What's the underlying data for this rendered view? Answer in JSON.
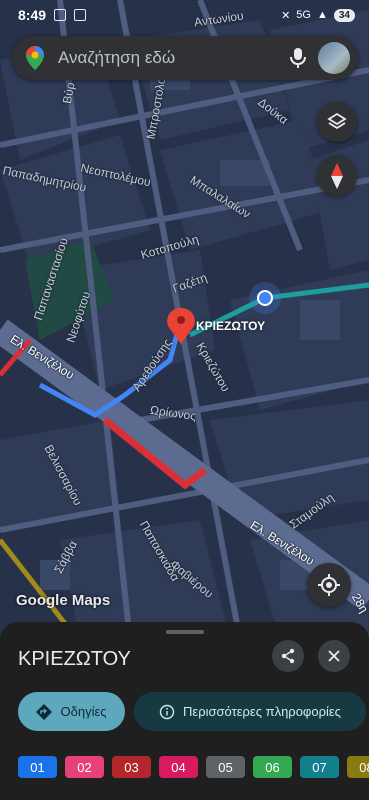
{
  "status_bar": {
    "time": "8:49",
    "network": "5G",
    "battery": "34"
  },
  "search": {
    "placeholder": "Αναζήτηση εδώ"
  },
  "map": {
    "street_labels": [
      "Αντωνίου",
      "Μπροστολού",
      "Δούκα",
      "Νεοπτολέμου",
      "Παπαδημητρίου",
      "Μπαλαλαίων",
      "Κοτοπούλη",
      "Γαζέτη",
      "Παπαναστασίου",
      "Νεοφύτου",
      "Ελ. Βενιζέλου",
      "Αρεθούσης",
      "Κριεζώτου",
      "Ωρίωνος",
      "Βελισσαρίου",
      "Παπασκιάδα",
      "Ελ. Βενιζέλου",
      "Σταμούλη",
      "Σάββα",
      "Φαβιέρου",
      "28η",
      "Βύρ"
    ],
    "place_label": "ΚΡΙΕΖΩΤΟΥ",
    "logo": "Google Maps"
  },
  "sheet": {
    "title": "ΚΡΙΕΖΩΤΟΥ",
    "directions_label": "Οδηγίες",
    "more_info_label": "Περισσότερες πληροφορίες",
    "lines": [
      {
        "label": "01",
        "color": "#1a73e8"
      },
      {
        "label": "02",
        "color": "#e8407a"
      },
      {
        "label": "03",
        "color": "#b3262b"
      },
      {
        "label": "04",
        "color": "#d81b60"
      },
      {
        "label": "05",
        "color": "#5f6368"
      },
      {
        "label": "06",
        "color": "#34a853"
      },
      {
        "label": "07",
        "color": "#12808c"
      },
      {
        "label": "08",
        "color": "#8a7a12"
      }
    ]
  },
  "colors": {
    "route_blue": "#4285f4",
    "route_red": "#d93036",
    "route_teal": "#1e9e9e",
    "route_olive": "#a08a18",
    "pin": "#ea4335",
    "location_dot": "#4285f4"
  }
}
